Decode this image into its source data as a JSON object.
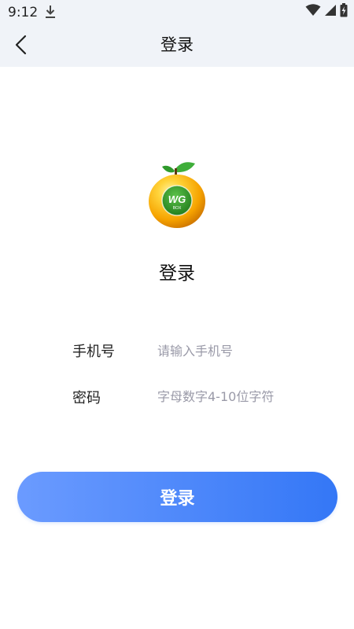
{
  "status_bar": {
    "time": "9:12"
  },
  "header": {
    "title": "登录"
  },
  "logo": {
    "text_main": "WG",
    "text_sub": "BOX"
  },
  "main": {
    "heading": "登录"
  },
  "form": {
    "phone": {
      "label": "手机号",
      "placeholder": "请输入手机号",
      "value": ""
    },
    "password": {
      "label": "密码",
      "placeholder": "字母数字4-10位字符",
      "value": ""
    }
  },
  "login_button": {
    "label": "登录"
  },
  "colors": {
    "accent_start": "#6b9bff",
    "accent_end": "#3477f6",
    "header_bg": "#f0f3f8"
  }
}
